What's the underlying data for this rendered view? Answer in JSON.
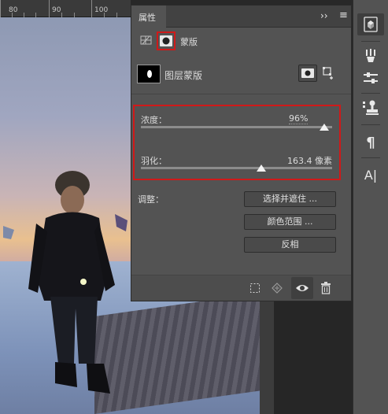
{
  "ruler": {
    "labels": [
      "80",
      "90",
      "100"
    ]
  },
  "panel": {
    "tab_label": "属性",
    "collapse_glyph": "››",
    "menu_glyph": "≡",
    "mask_type_label": "蒙版",
    "layer_mask_label": "图层蒙版",
    "density": {
      "label": "浓度：",
      "value": "96%",
      "level": 0.96
    },
    "feather": {
      "label": "羽化：",
      "value": "163.4 像素",
      "level": 0.63
    },
    "refine_label": "调整：",
    "buttons": {
      "select_and_mask": "选择并遮住 ...",
      "color_range": "颜色范围 ...",
      "invert": "反相"
    }
  },
  "toolbar": {
    "paragraph_glyph": "¶",
    "character_glyph": "A|"
  }
}
